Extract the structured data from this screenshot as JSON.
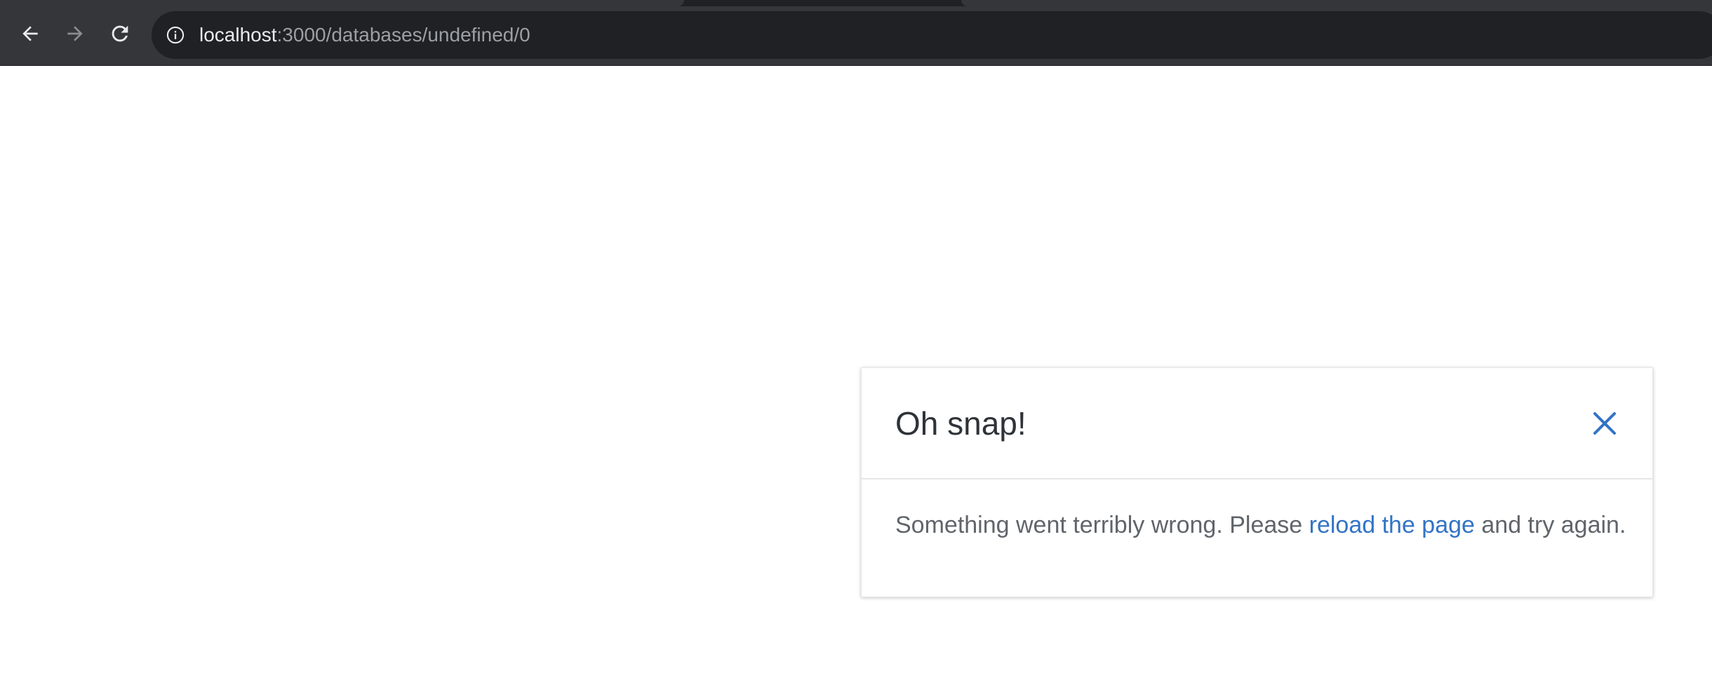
{
  "browser": {
    "url_host": "localhost",
    "url_path": ":3000/databases/undefined/0",
    "back_icon": "arrow-left-icon",
    "forward_icon": "arrow-right-icon",
    "reload_icon": "reload-icon",
    "info_icon": "info-icon",
    "colors": {
      "chrome_bg": "#35363a",
      "omnibox_bg": "#202124",
      "url_host": "#e8eaed",
      "url_path": "#9aa0a6"
    }
  },
  "error_toast": {
    "title": "Oh snap!",
    "close_icon": "close-icon",
    "message_before": "Something went terribly wrong. Please ",
    "link_text": "reload the page",
    "message_after": " and try again.",
    "colors": {
      "title": "#2e3338",
      "body": "#60656b",
      "accent": "#3273c6",
      "divider": "#e5e6e8"
    }
  }
}
